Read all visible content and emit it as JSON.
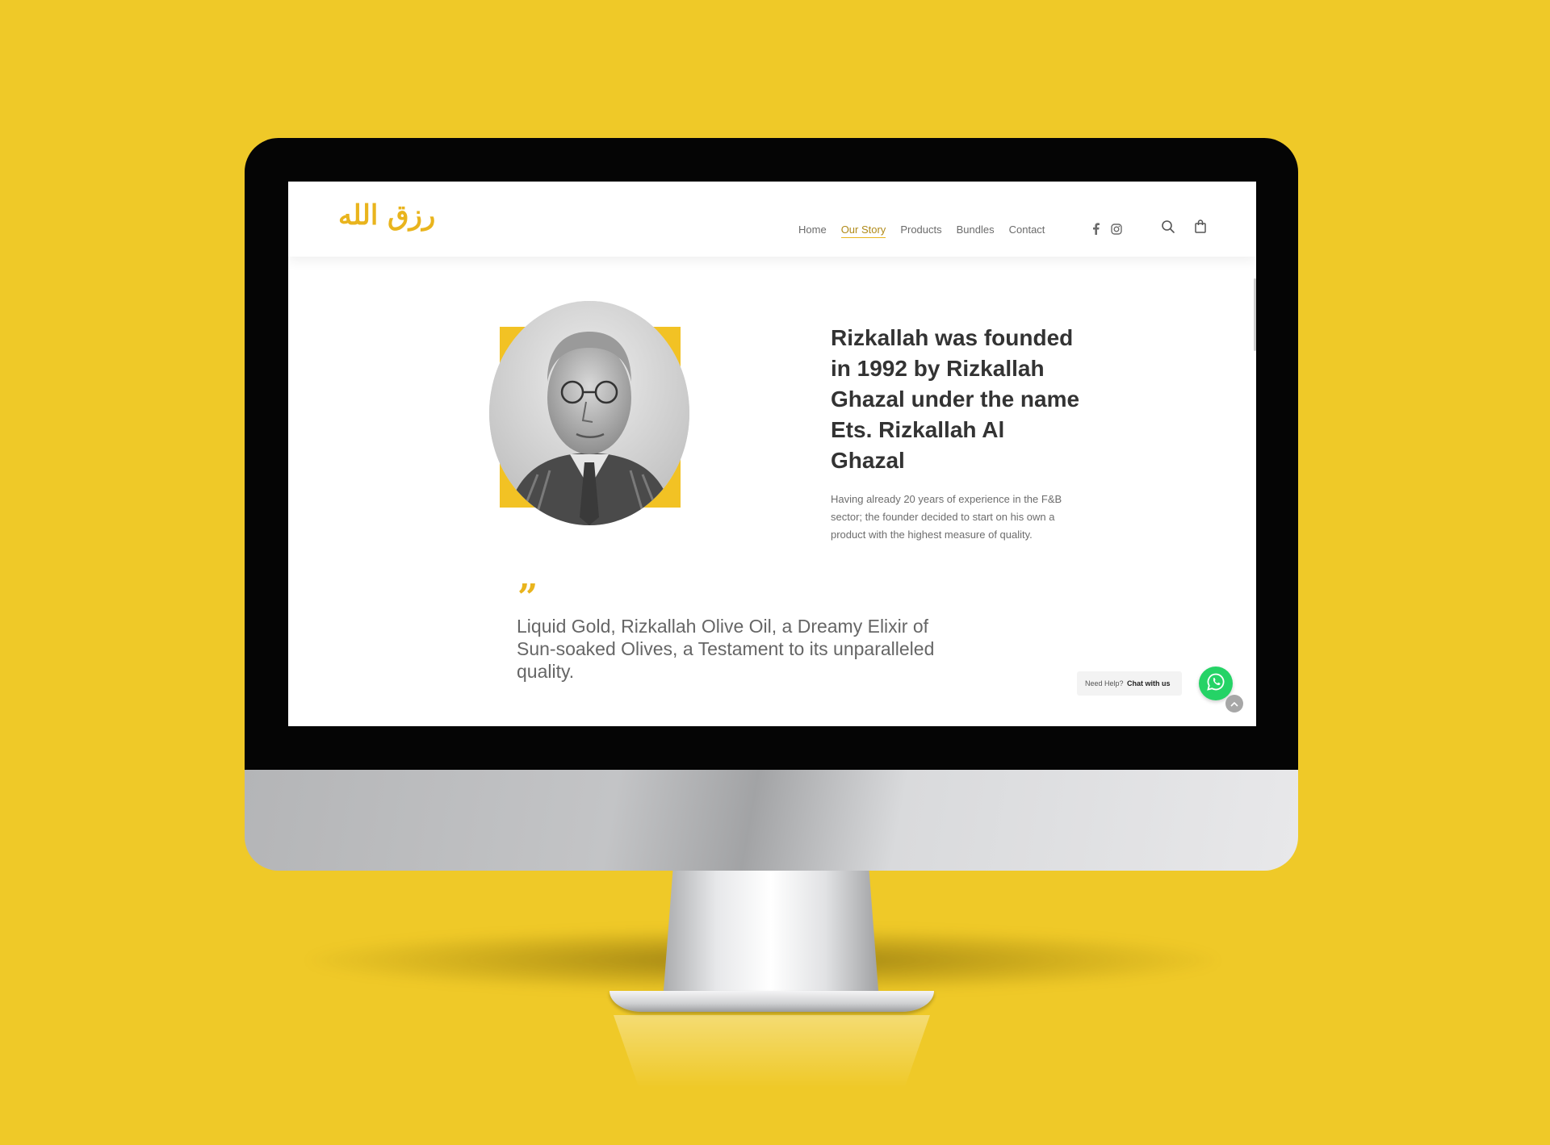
{
  "colors": {
    "background": "#EFC928",
    "accent": "#E9B41D",
    "whatsapp": "#25D366"
  },
  "header": {
    "logo_text": "رزق الله",
    "nav": [
      {
        "label": "Home"
      },
      {
        "label": "Our Story",
        "active": true
      },
      {
        "label": "Products"
      },
      {
        "label": "Bundles"
      },
      {
        "label": "Contact"
      }
    ],
    "social_icons": [
      "facebook-icon",
      "instagram-icon"
    ],
    "tool_icons": [
      "search-icon",
      "shopping-bag-icon"
    ]
  },
  "story": {
    "heading": "Rizkallah was founded in 1992 by Rizkallah Ghazal under the name Ets. Rizkallah Al Ghazal",
    "paragraph": "Having already 20 years of experience in the F&B sector; the founder decided to start on his own a product with the highest measure of quality."
  },
  "quote": {
    "mark": "”",
    "text": "Liquid Gold, Rizkallah Olive Oil, a Dreamy Elixir of Sun-soaked Olives, a Testament to its unparalleled quality."
  },
  "chat": {
    "prompt": "Need Help?",
    "action": "Chat with us"
  }
}
